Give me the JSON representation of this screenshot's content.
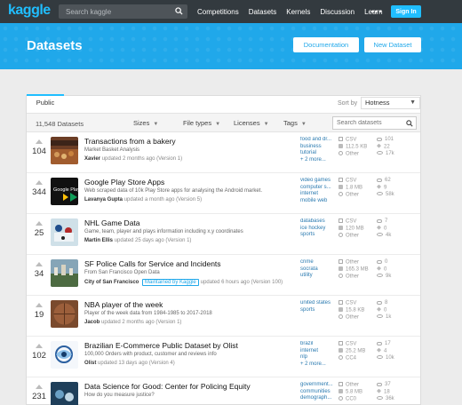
{
  "nav": {
    "logo": "kaggle",
    "search_placeholder": "Search kaggle",
    "links": [
      "Competitions",
      "Datasets",
      "Kernels",
      "Discussion",
      "Learn"
    ],
    "more": "•••",
    "signin": "Sign In"
  },
  "header": {
    "title": "Datasets",
    "documentation": "Documentation",
    "new_dataset": "New Dataset"
  },
  "panel": {
    "tab": "Public",
    "sort_label": "Sort by",
    "sort_value": "Hotness",
    "count": "11,548 Datasets",
    "filters": [
      "Sizes",
      "File types",
      "Licenses",
      "Tags"
    ],
    "search_placeholder": "Search datasets"
  },
  "datasets": [
    {
      "votes": "104",
      "title": "Transactions from a bakery",
      "subtitle": "Market Basket Analysis",
      "owner": "Xavier",
      "maintained": "",
      "updated": "updated 2 months ago (Version 1)",
      "tags": [
        "food and dr...",
        "business",
        "tutorial",
        "+ 2 more..."
      ],
      "stats": [
        "CSV",
        "112.5 KB",
        "Other"
      ],
      "stats2": [
        "101",
        "22",
        "17k"
      ],
      "thumb": "bakery"
    },
    {
      "votes": "344",
      "title": "Google Play Store Apps",
      "subtitle": "Web scraped data of 10k Play Store apps for analysing the Android market.",
      "owner": "Lavanya Gupta",
      "maintained": "",
      "updated": "updated a month ago (Version 5)",
      "tags": [
        "video games",
        "computer s...",
        "internet",
        "mobile web"
      ],
      "stats": [
        "CSV",
        "1.8 MB",
        "Other"
      ],
      "stats2": [
        "62",
        "9",
        "58k"
      ],
      "thumb": "google"
    },
    {
      "votes": "25",
      "title": "NHL Game Data",
      "subtitle": "Game, team, player and plays information including x,y coordinates",
      "owner": "Martin Ellis",
      "maintained": "",
      "updated": "updated 25 days ago (Version 1)",
      "tags": [
        "databases",
        "ice hockey",
        "sports"
      ],
      "stats": [
        "CSV",
        "120 MB",
        "Other"
      ],
      "stats2": [
        "7",
        "0",
        "4k"
      ],
      "thumb": "nhl"
    },
    {
      "votes": "34",
      "title": "SF Police Calls for Service and Incidents",
      "subtitle": "From San Francisco Open Data",
      "owner": "City of San Francisco",
      "maintained": "Maintained by Kaggle",
      "updated": "updated 6 hours ago (Version 100)",
      "tags": [
        "crime",
        "socrata",
        "utility"
      ],
      "stats": [
        "Other",
        "165.3 MB",
        "Other"
      ],
      "stats2": [
        "0",
        "0",
        "9k"
      ],
      "thumb": "sf"
    },
    {
      "votes": "19",
      "title": "NBA player of the week",
      "subtitle": "Player of the week data from 1984-1985 to 2017-2018",
      "owner": "Jacob",
      "maintained": "",
      "updated": "updated 2 months ago (Version 1)",
      "tags": [
        "united states",
        "sports"
      ],
      "stats": [
        "CSV",
        "15.8 KB",
        "Other"
      ],
      "stats2": [
        "8",
        "0",
        "1k"
      ],
      "thumb": "nba"
    },
    {
      "votes": "102",
      "title": "Brazilian E-Commerce Public Dataset by Olist",
      "subtitle": "100,000 Orders with product, customer and reviews info",
      "owner": "Olist",
      "maintained": "",
      "updated": "updated 13 days ago (Version 4)",
      "tags": [
        "brazil",
        "internet",
        "nlp",
        "+ 2 more..."
      ],
      "stats": [
        "CSV",
        "25.2 MB",
        "CC4"
      ],
      "stats2": [
        "17",
        "4",
        "10k"
      ],
      "thumb": "olist"
    },
    {
      "votes": "231",
      "title": "Data Science for Good: Center for Policing Equity",
      "subtitle": "How do you measure justice?",
      "owner": "",
      "maintained": "",
      "updated": "",
      "tags": [
        "government...",
        "communities",
        "demograph..."
      ],
      "stats": [
        "Other",
        "5.8 MB",
        "CC0"
      ],
      "stats2": [
        "37",
        "18",
        "36k"
      ],
      "thumb": "cpe"
    }
  ],
  "colors": {
    "nav_bg": "#333a3f",
    "accent": "#20beff",
    "header_bg": "#20a8ea",
    "tag_link": "#2a7ab0"
  }
}
